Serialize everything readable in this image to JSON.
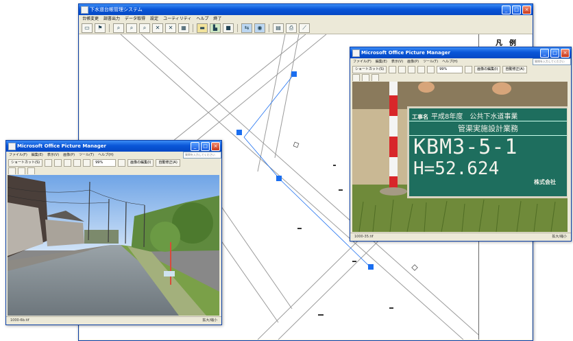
{
  "main_window": {
    "title": "下水道台帳管理システム",
    "menu": [
      "台帳変更",
      "調書出力",
      "データ取得",
      "設定",
      "ユーティリティ",
      "ヘルプ",
      "終了"
    ],
    "legend_label": "凡　例"
  },
  "photo_viewer_left": {
    "title": "Microsoft Office Picture Manager",
    "menu": [
      "ファイル(F)",
      "編集(E)",
      "表示(V)",
      "画像(P)",
      "ツール(T)",
      "ヘルプ(H)"
    ],
    "search_placeholder": "質問を入力してください",
    "shortcuts_button": "ショートカット(S)",
    "edit_button": "画像の編集(I)",
    "autofix_button": "自動修正(A)",
    "zoom": "99%",
    "status_left": "1000-6b.tif",
    "status_zoom": "拡大/縮小"
  },
  "photo_viewer_right": {
    "title": "Microsoft Office Picture Manager",
    "menu": [
      "ファイル(F)",
      "編集(E)",
      "表示(V)",
      "画像(P)",
      "ツール(T)",
      "ヘルプ(H)"
    ],
    "search_placeholder": "質問を入力してください",
    "shortcuts_button": "ショートカット(S)",
    "edit_button": "画像の編集(I)",
    "autofix_button": "自動修正(A)",
    "zoom": "99%",
    "status_left": "1000-35.tif",
    "status_zoom": "拡大/縮小",
    "board": {
      "line1_label": "工事名",
      "line1_text": "平成8年度　公共下水道事業",
      "line2": "管渠実施設計業務",
      "line3": "KBM3-5-1",
      "line4": "H=52.624",
      "line5": "株式会社"
    }
  },
  "colors": {
    "xp_title": "#0a56d8",
    "manhole_blue": "#1a6ef0",
    "board_green": "#1e6e5e"
  }
}
